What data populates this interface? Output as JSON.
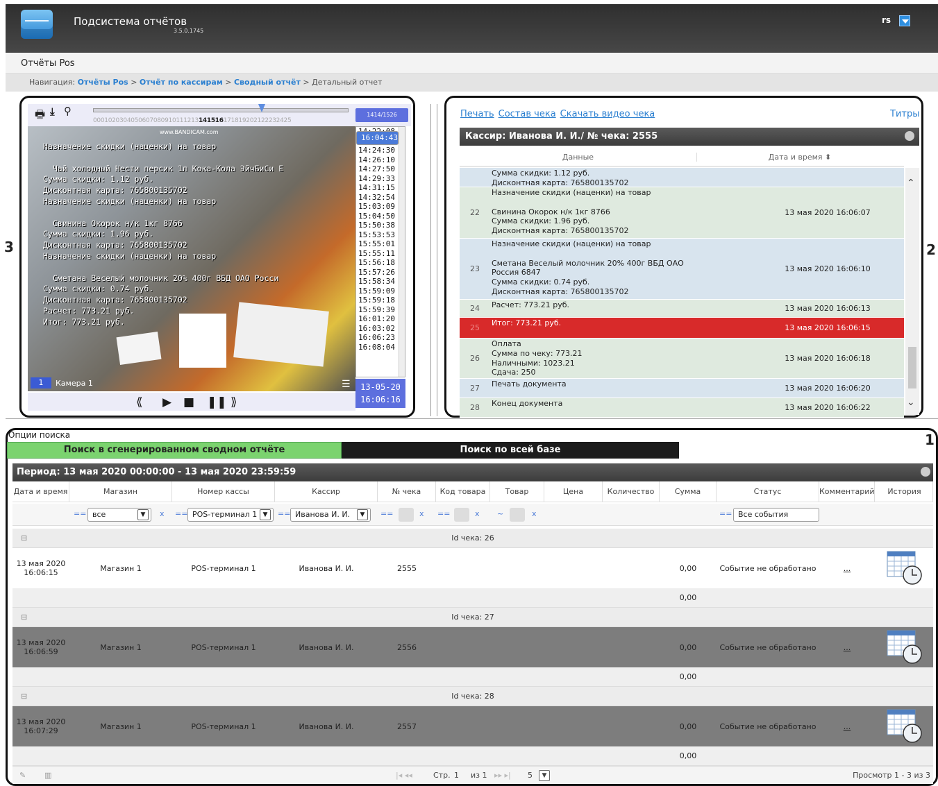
{
  "app": {
    "title": "Подсистема отчётов",
    "version": "3.5.0.1745",
    "user": "rs"
  },
  "page": {
    "subtitle": "Отчёты Pos"
  },
  "nav": {
    "prefix": "Навигация:",
    "items": [
      "Отчёты Pos",
      "Отчёт по кассирам",
      "Сводный отчёт"
    ],
    "current": "Детальный отчет",
    "sep": ">"
  },
  "callouts": {
    "one": "1",
    "two": "2",
    "three": "3"
  },
  "player": {
    "counter": "1414/1526",
    "timeline_labels": "0001020304050607080910111213",
    "timeline_active": "141516",
    "timeline_rest": "171819202122232425",
    "watermark": "www.BANDICAM.com",
    "overlay_text": "Назначение скидки (наценки) на товар\n\n  Чай холодный Нести персик 1л Кока-Кола ЭйчБиСи Е\nСумма скидки: 1.12 руб.\nДисконтная карта: 765800135702\nНазначение скидки (наценки) на товар\n\n  Свинина Окорок н/к 1кг 8766\nСумма скидки: 1.96 руб.\nДисконтная карта: 765800135702\nНазначение скидки (наценки) на товар\n\n  Сметана Веселый молочник 20% 400г ВБД ОАО Росси\nСумма скидки: 0.74 руб.\nДисконтная карта: 765800135702\nРасчет: 773.21 руб.\nИтог: 773.21 руб.",
    "camera_num": "1",
    "camera_label": "Камера 1",
    "times": [
      "14:22:08",
      "14:22:50",
      "14:24:30",
      "14:26:10",
      "14:27:50",
      "14:29:33",
      "14:31:15",
      "14:32:54",
      "15:03:09",
      "15:04:50",
      "15:50:38",
      "15:53:53",
      "15:55:01",
      "15:55:11",
      "15:56:18",
      "15:57:26",
      "15:58:34",
      "15:59:09",
      "15:59:18",
      "15:59:39",
      "16:01:20",
      "16:03:02",
      "16:04:43",
      "16:06:23",
      "16:08:04"
    ],
    "selected_time": "16:04:43",
    "date": "13-05-20",
    "time": "16:06:16"
  },
  "receipt": {
    "links": [
      "Печать",
      "Состав чека",
      "Скачать видео чека"
    ],
    "titry": "Титры",
    "header": "Кассир: Иванова И. И./ № чека: 2555",
    "col_data": "Данные",
    "col_time": "Дата и время",
    "rows": [
      {
        "n": "",
        "data": "Сумма скидки: 1.12 руб.\nДисконтная карта: 765800135702",
        "time": "",
        "cls": "b"
      },
      {
        "n": "22",
        "data": "Назначение скидки (наценки) на товар\n\nСвинина Окорок н/к 1кг 8766\nСумма скидки: 1.96 руб.\nДисконтная карта: 765800135702",
        "time": "13 мая 2020 16:06:07",
        "cls": "g"
      },
      {
        "n": "23",
        "data": "Назначение скидки (наценки) на товар\n\nСметана Веселый молочник 20% 400г ВБД ОАО\nРоссия 6847\nСумма скидки: 0.74 руб.\nДисконтная карта: 765800135702",
        "time": "13 мая 2020 16:06:10",
        "cls": "b"
      },
      {
        "n": "24",
        "data": "Расчет: 773.21 руб.",
        "time": "13 мая 2020 16:06:13",
        "cls": "g"
      },
      {
        "n": "25",
        "data": "Итог: 773.21 руб.",
        "time": "13 мая 2020 16:06:15",
        "cls": "r"
      },
      {
        "n": "26",
        "data": "Оплата\nСумма по чеку: 773.21\nНаличными: 1023.21\nСдача: 250",
        "time": "13 мая 2020 16:06:18",
        "cls": "g"
      },
      {
        "n": "27",
        "data": "Печать документа",
        "time": "13 мая 2020 16:06:20",
        "cls": "b"
      },
      {
        "n": "28",
        "data": "Конец документа",
        "time": "13 мая 2020 16:06:22",
        "cls": "g"
      }
    ]
  },
  "search": {
    "options_label": "Опции поиска",
    "tab_summary": "Поиск в сгенерированном сводном отчёте",
    "tab_all": "Поиск по всей базе",
    "period": "Период: 13 мая 2020 00:00:00 - 13 мая 2020 23:59:59",
    "columns": [
      "Дата и время",
      "Магазин",
      "Номер кассы",
      "Кассир",
      "№ чека",
      "Код товара",
      "Товар",
      "Цена",
      "Количество",
      "Сумма",
      "Статус",
      "Комментарий",
      "История"
    ],
    "filters": {
      "store": "все",
      "pos": "POS-терминал 1",
      "cashier": "Иванова И. И.",
      "status": "Все события"
    },
    "groups": [
      {
        "label": "Id чека: 26",
        "date": "13 мая 2020\n16:06:15",
        "store": "Магазин 1",
        "pos": "POS-терминал 1",
        "cashier": "Иванова И. И.",
        "check": "2555",
        "sum": "0,00",
        "status": "Событие не обработано",
        "comment": "...",
        "total": "0,00",
        "dark": false
      },
      {
        "label": "Id чека: 27",
        "date": "13 мая 2020\n16:06:59",
        "store": "Магазин 1",
        "pos": "POS-терминал 1",
        "cashier": "Иванова И. И.",
        "check": "2556",
        "sum": "0,00",
        "status": "Событие не обработано",
        "comment": "...",
        "total": "0,00",
        "dark": true
      },
      {
        "label": "Id чека: 28",
        "date": "13 мая 2020\n16:07:29",
        "store": "Магазин 1",
        "pos": "POS-терминал 1",
        "cashier": "Иванова И. И.",
        "check": "2557",
        "sum": "0,00",
        "status": "Событие не обработано",
        "comment": "...",
        "total": "0,00",
        "dark": true
      }
    ],
    "pager": {
      "page_label": "Стр.",
      "page": "1",
      "of": "из 1",
      "page_size": "5",
      "view": "Просмотр 1 - 3 из 3"
    }
  }
}
